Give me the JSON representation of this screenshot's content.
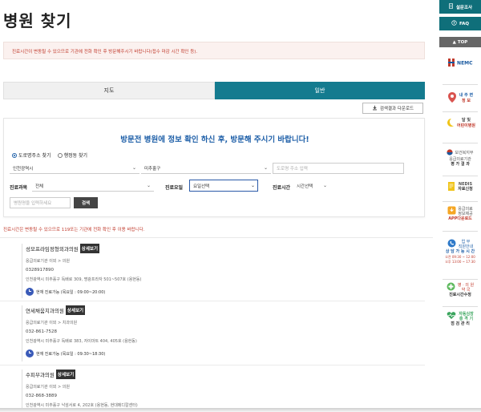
{
  "page": {
    "title": "병원 찾기",
    "notice": "진료시간이 변동될 수 있으므로 기관에 전화 확인 후 방문해주시기 바랍니다(접수 마감 시간 확인 등).",
    "tabs": [
      "지도",
      "일반"
    ],
    "download_label": "검색결과 다운로드"
  },
  "search": {
    "headline": "방문전 병원에 정보 확인 하신 후, 방문해 주시기 바랍니다!",
    "radio_road": "도로명주소 찾기",
    "radio_lot": "행정동 찾기",
    "city": "인천광역시",
    "district": "미추홀구",
    "road_placeholder": "도로명 주소 입력",
    "dept_label": "진료과목",
    "dept_value": "전체",
    "day_label": "진료요일",
    "day_value": "요일선택",
    "time_label": "진료시간",
    "time_value": "시간선택",
    "name_placeholder": "병원명을 입력하세요",
    "search_label": "검색"
  },
  "results": {
    "warning": "진료시간은 변동될 수 있으므로 119또는 기관에 전화 확인 후 이용 바랍니다.",
    "detail_label": "상세보기",
    "items": [
      {
        "name": "성모프라임정형외과의원",
        "type": "응급의료기관 이외 > 의원",
        "phone": "0328917890",
        "address": "인천광역시 미추홀구 독배로 309, 명광프라자 501~507호 (용현동)",
        "status": "현재 진료가능 (목요일 : 09:00~20:00)"
      },
      {
        "name": "연세채움치과의원",
        "type": "응급의료기관 이외 > 치과의원",
        "phone": "032-861-7528",
        "address": "인천광역시 미추홀구 독배로 383, 자이마트 404, 405호 (용현동)",
        "status": "현재 진료가능 (목요일 : 09:30~18:30)"
      },
      {
        "name": "수피부과의원",
        "type": "응급의료기관 이외 > 의원",
        "phone": "032-868-3889",
        "address": "인천광역시 미추홀구 낙섬서로 4, 202호 (용현동, 현대메디칼센터)",
        "status": ""
      }
    ]
  },
  "sidebar": {
    "survey": "설문조사",
    "faq": "FAQ",
    "top": "TOP",
    "nemc": "NEMC",
    "nearby_1": "내 주 변",
    "nearby_2": "정 보",
    "moon_1": "달 빛",
    "moon_2": "어린이병원",
    "eval_1": "보건복지부",
    "eval_2": "응급의료기관",
    "eval_3": "평 가 결 과",
    "nedis_1": "NEDIS",
    "nedis_2": "자료신청",
    "app_1": "응급의료",
    "app_2": "정보제공",
    "app_3": "APP다운로드",
    "work_1": "업 무",
    "work_2": "직원안내",
    "consult": "상 담 가 능 시 간",
    "consult_t1": "오전 09:30 ~ 12:00",
    "consult_t2": "오후 13:00 ~ 17:30",
    "hosp_1": "병 · 의 원",
    "hosp_2": "약 국",
    "hosp_3": "진료시간수정",
    "aed_1": "자동심장",
    "aed_2": "충 격 기",
    "aed_3": "점 검 관 리"
  },
  "colors": {
    "accent": "#147b8f",
    "alert": "#c0392b",
    "headline": "#1e5fa8"
  }
}
